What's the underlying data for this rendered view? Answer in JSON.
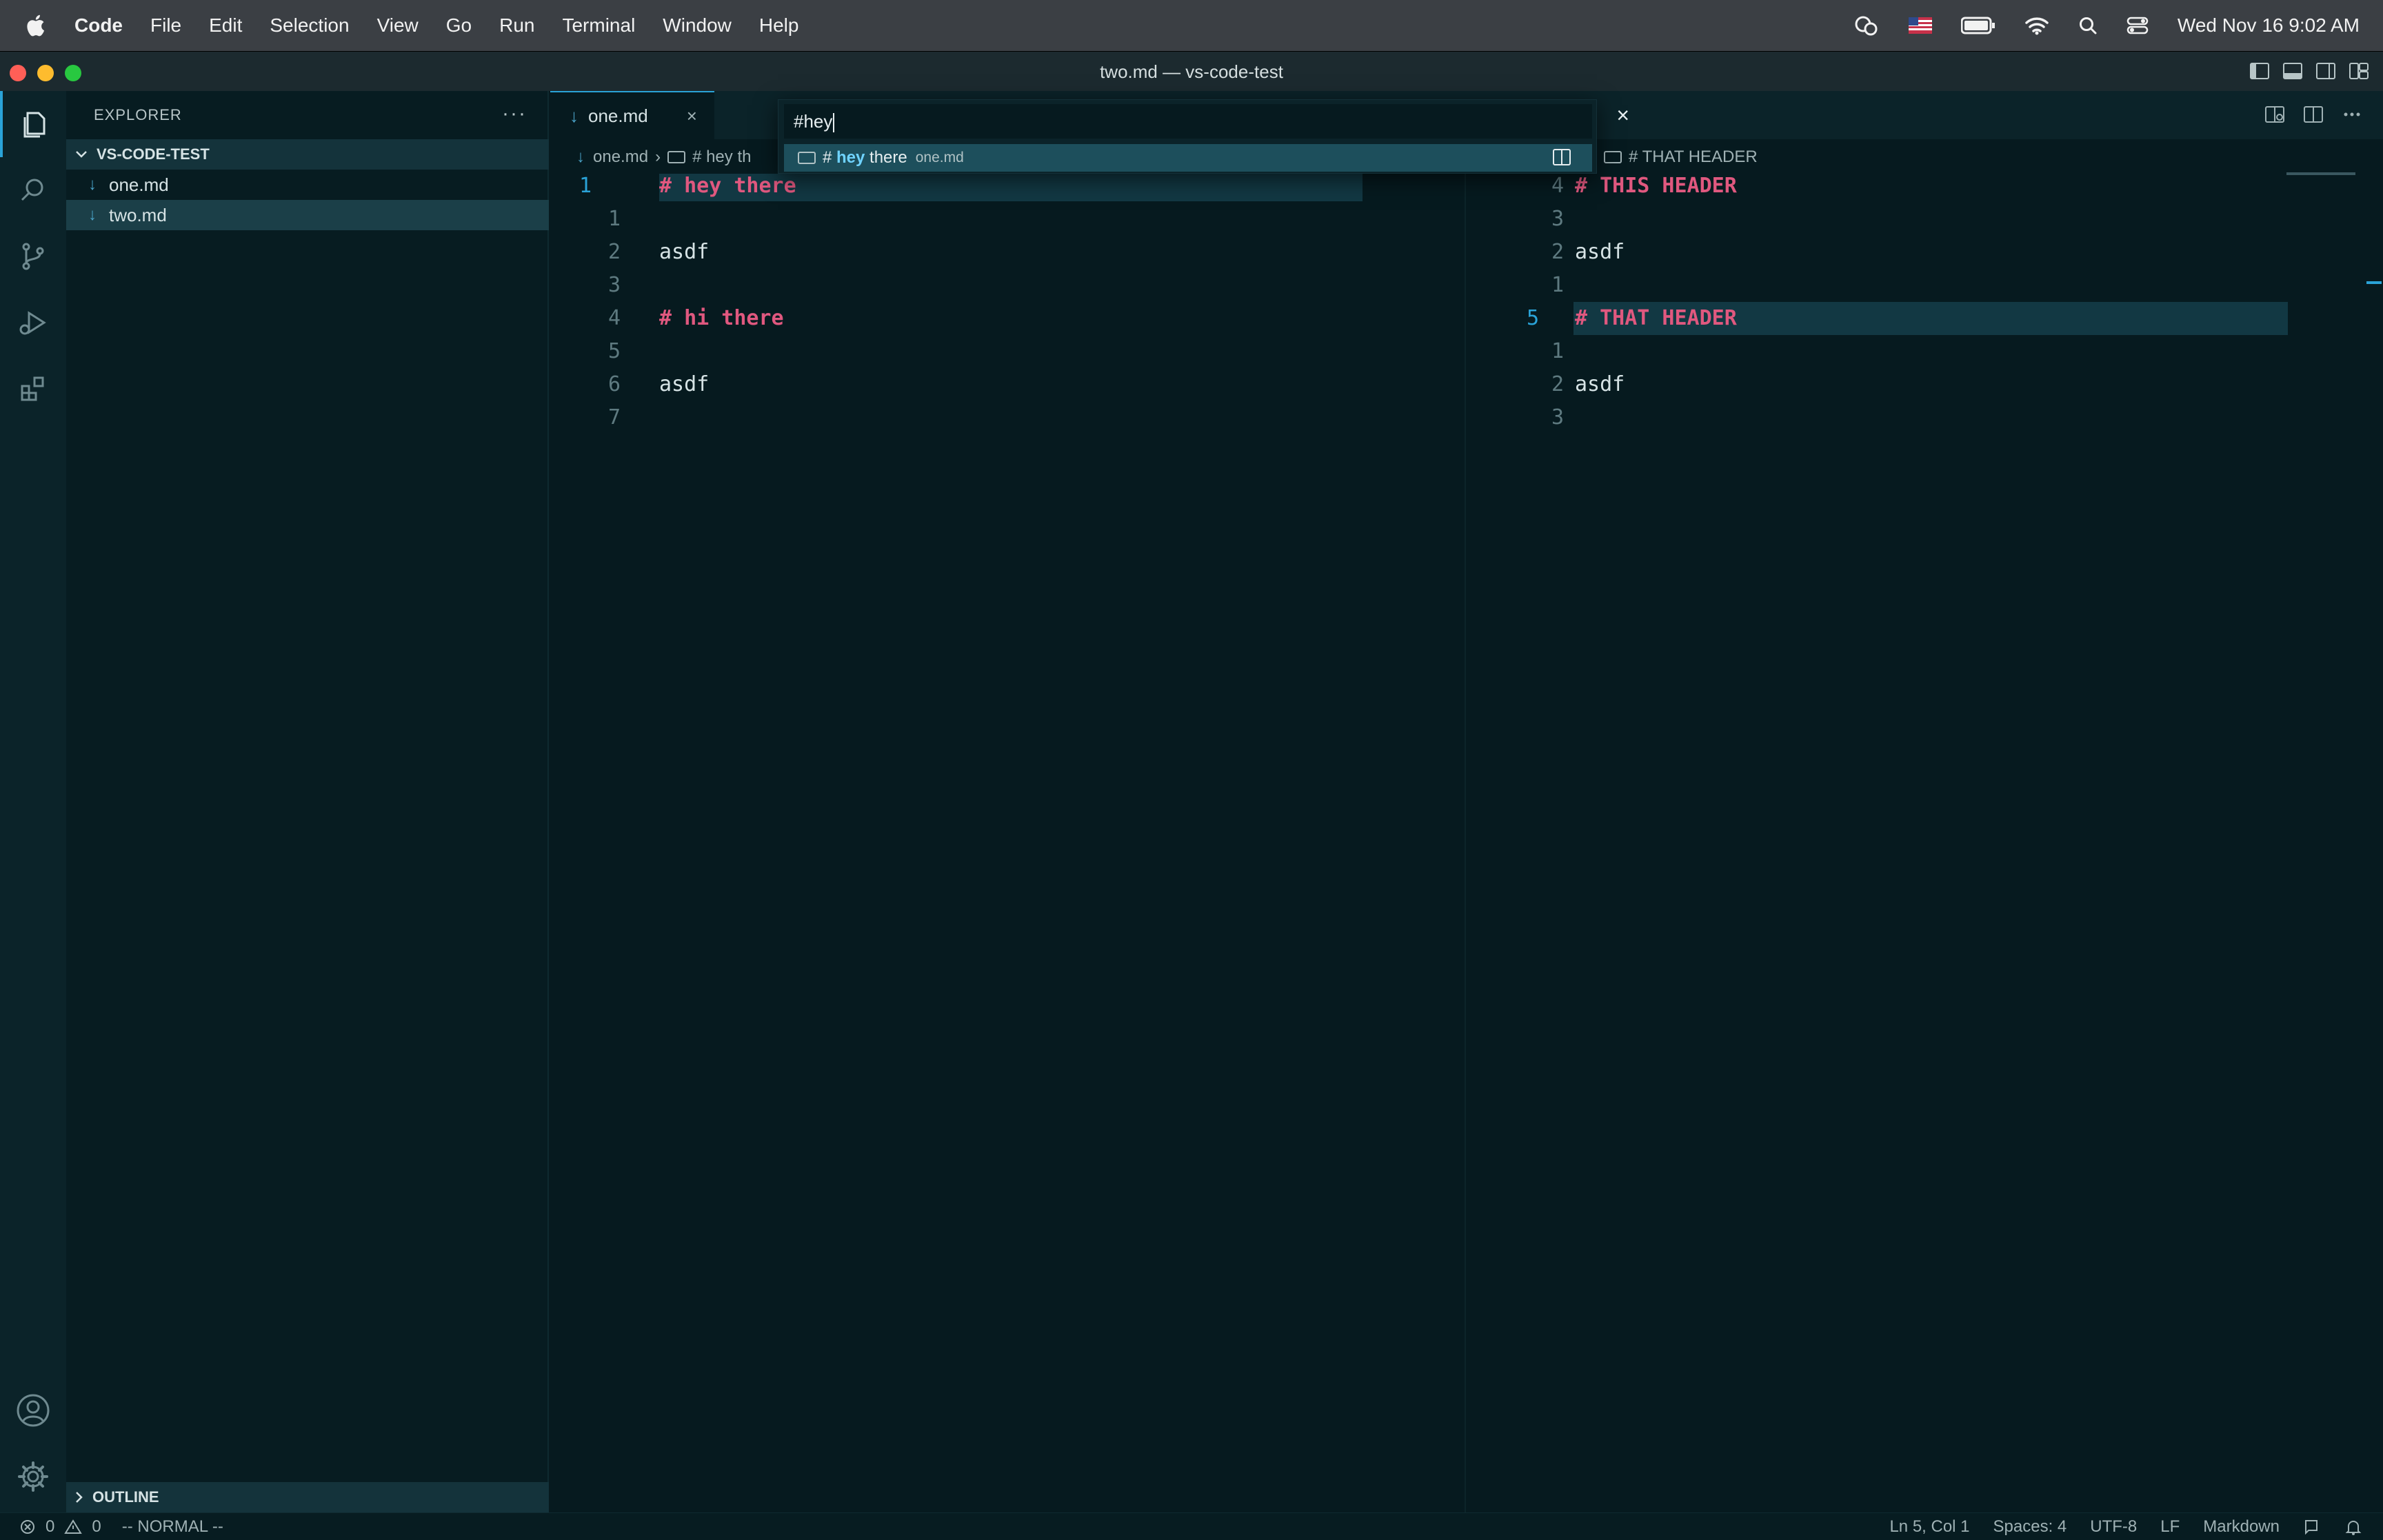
{
  "menubar": {
    "app_name": "Code",
    "items": [
      "File",
      "Edit",
      "Selection",
      "View",
      "Go",
      "Run",
      "Terminal",
      "Window",
      "Help"
    ],
    "clock": "Wed Nov 16  9:02 AM"
  },
  "window": {
    "title": "two.md — vs-code-test"
  },
  "sidebar": {
    "header": "EXPLORER",
    "more": "···",
    "folder": "VS-CODE-TEST",
    "files": [
      "one.md",
      "two.md"
    ],
    "outline": "OUTLINE"
  },
  "editor": {
    "tabs": [
      {
        "label": "one.md",
        "close": "×"
      }
    ],
    "left": {
      "breadcrumb": {
        "file": "one.md",
        "symbol": "# hey th"
      },
      "line_numbers": [
        "1",
        "1",
        "2",
        "3",
        "4",
        "5",
        "6",
        "7"
      ],
      "lines": [
        "# hey there",
        "",
        "asdf",
        "",
        "# hi there",
        "",
        "asdf",
        ""
      ]
    },
    "right": {
      "breadcrumb": {
        "symbol": "# THAT HEADER"
      },
      "line_numbers": [
        "4",
        "3",
        "2",
        "1",
        "5",
        "1",
        "2",
        "3"
      ],
      "lines": [
        "# THIS HEADER",
        "",
        "asdf",
        "",
        "# THAT HEADER",
        "",
        "asdf",
        ""
      ]
    }
  },
  "quickopen": {
    "query": "#hey",
    "close": "×",
    "result": {
      "prefix": "# ",
      "match": "hey",
      "rest": " there",
      "file": "one.md"
    }
  },
  "statusbar": {
    "errors": "0",
    "warnings": "0",
    "mode": "-- NORMAL --",
    "position": "Ln 5, Col 1",
    "spaces": "Spaces: 4",
    "encoding": "UTF-8",
    "eol": "LF",
    "language": "Markdown"
  },
  "colors": {
    "accent": "#2aa3d8",
    "header_text": "#e0587f",
    "background": "#061a1f"
  }
}
